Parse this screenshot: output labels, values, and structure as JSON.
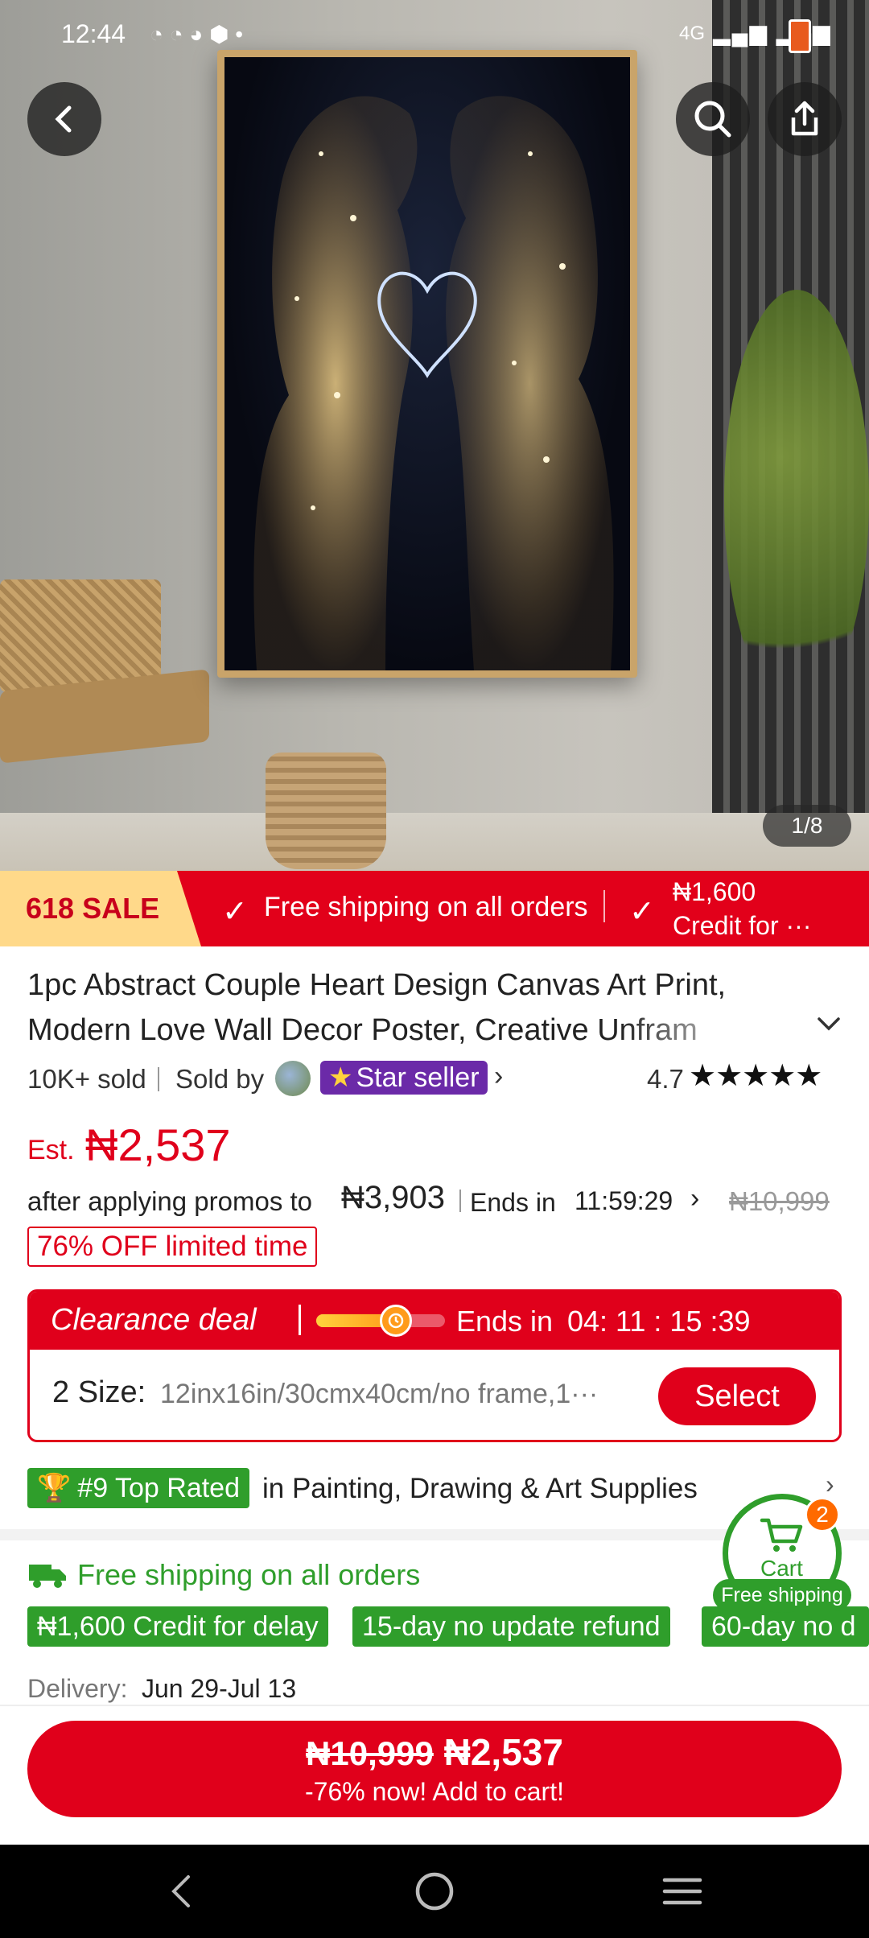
{
  "status_bar": {
    "time": "12:44",
    "network": "4G"
  },
  "gallery": {
    "counter": "1/8"
  },
  "sale_strip": {
    "tag": "618 SALE",
    "benefit_1": "Free shipping on all orders",
    "benefit_2_line1": "₦1,600",
    "benefit_2_line2": "Credit for ···"
  },
  "product": {
    "title_line1": "1pc Abstract Couple Heart Design Canvas Art Print,",
    "title_line2": "Modern Love Wall Decor Poster, Creative Unfram",
    "sold": "10K+ sold",
    "sold_by": "Sold by",
    "seller_badge": "Star seller",
    "rating": "4.7"
  },
  "price": {
    "est_label": "Est.",
    "est_value": "₦2,537",
    "after_promos": "after applying promos to",
    "promo_price": "₦3,903",
    "ends_label": "Ends in",
    "ends_timer": "11:59:29",
    "original": "₦10,999",
    "discount_tag": "76% OFF limited time"
  },
  "clearance": {
    "title": "Clearance deal",
    "ends_label": "Ends in",
    "timer": "04: 11 : 15 :39",
    "progress": 0.62,
    "size_label": "2 Size:",
    "size_value": "12inx16in/30cmx40cm/no frame,1···",
    "select_label": "Select"
  },
  "ranking": {
    "badge": "#9 Top Rated",
    "category": "in Painting, Drawing & Art Supplies"
  },
  "shipping": {
    "headline": "Free shipping on all orders",
    "chips": [
      "₦1,600 Credit for delay",
      "15-day no update refund",
      "60-day no d"
    ],
    "delivery_label": "Delivery:",
    "delivery_value": "Jun 29-Jul 13"
  },
  "cart_float": {
    "count": "2",
    "label": "Cart",
    "sub": "Free shipping"
  },
  "cta": {
    "old_price": "₦10,999",
    "new_price": "₦2,537",
    "line2": "-76% now! Add to cart!"
  },
  "colors": {
    "accent_red": "#e0001b",
    "green": "#2f9e2b",
    "purple": "#6b2aa8"
  }
}
